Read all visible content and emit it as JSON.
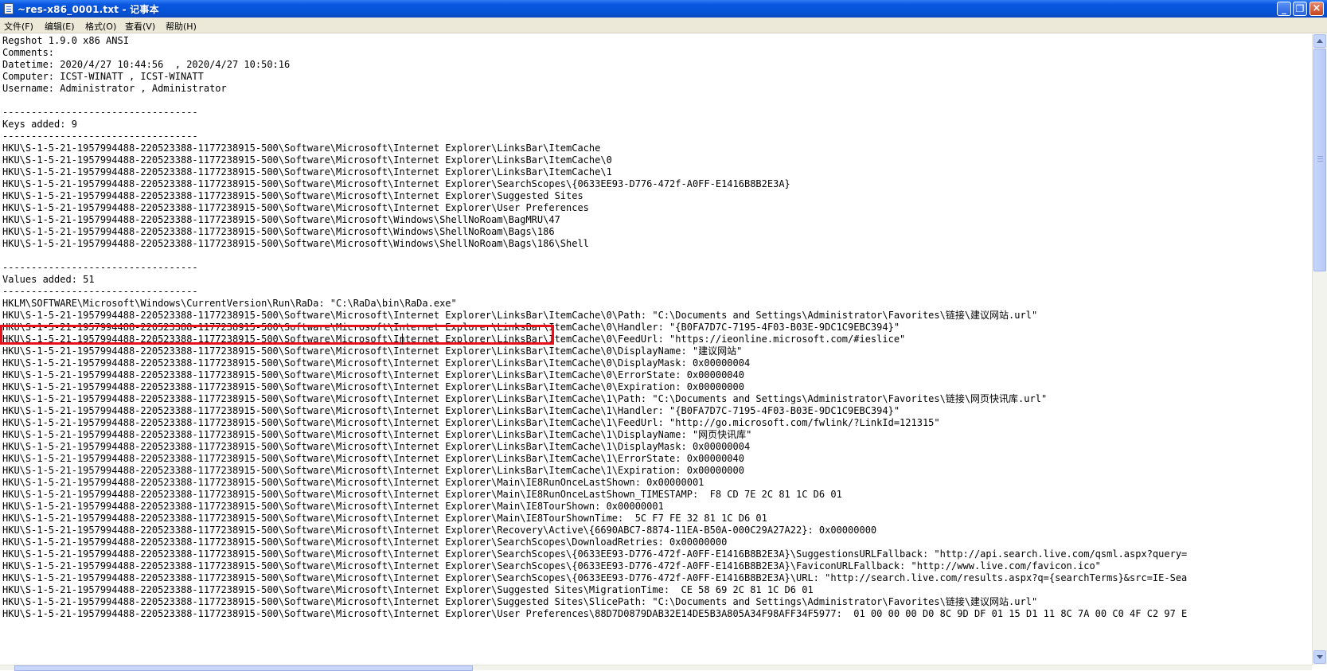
{
  "window": {
    "title": "~res-x86_0001.txt - 记事本"
  },
  "menu": [
    "文件(F)",
    "编辑(E)",
    "格式(O)",
    "查看(V)",
    "帮助(H)"
  ],
  "lines": [
    "Regshot 1.9.0 x86 ANSI",
    "Comments:",
    "Datetime: 2020/4/27 10:44:56  , 2020/4/27 10:50:16",
    "Computer: ICST-WINATT , ICST-WINATT",
    "Username: Administrator , Administrator",
    "",
    "----------------------------------",
    "Keys added: 9",
    "----------------------------------",
    "HKU\\S-1-5-21-1957994488-220523388-1177238915-500\\Software\\Microsoft\\Internet Explorer\\LinksBar\\ItemCache",
    "HKU\\S-1-5-21-1957994488-220523388-1177238915-500\\Software\\Microsoft\\Internet Explorer\\LinksBar\\ItemCache\\0",
    "HKU\\S-1-5-21-1957994488-220523388-1177238915-500\\Software\\Microsoft\\Internet Explorer\\LinksBar\\ItemCache\\1",
    "HKU\\S-1-5-21-1957994488-220523388-1177238915-500\\Software\\Microsoft\\Internet Explorer\\SearchScopes\\{0633EE93-D776-472f-A0FF-E1416B8B2E3A}",
    "HKU\\S-1-5-21-1957994488-220523388-1177238915-500\\Software\\Microsoft\\Internet Explorer\\Suggested Sites",
    "HKU\\S-1-5-21-1957994488-220523388-1177238915-500\\Software\\Microsoft\\Internet Explorer\\User Preferences",
    "HKU\\S-1-5-21-1957994488-220523388-1177238915-500\\Software\\Microsoft\\Windows\\ShellNoRoam\\BagMRU\\47",
    "HKU\\S-1-5-21-1957994488-220523388-1177238915-500\\Software\\Microsoft\\Windows\\ShellNoRoam\\Bags\\186",
    "HKU\\S-1-5-21-1957994488-220523388-1177238915-500\\Software\\Microsoft\\Windows\\ShellNoRoam\\Bags\\186\\Shell",
    "",
    "----------------------------------",
    "Values added: 51",
    "----------------------------------",
    "HKLM\\SOFTWARE\\Microsoft\\Windows\\CurrentVersion\\Run\\RaDa: \"C:\\RaDa\\bin\\RaDa.exe\"",
    "HKU\\S-1-5-21-1957994488-220523388-1177238915-500\\Software\\Microsoft\\Internet Explorer\\LinksBar\\ItemCache\\0\\Path: \"C:\\Documents and Settings\\Administrator\\Favorites\\链接\\建议网站.url\"",
    "HKU\\S-1-5-21-1957994488-220523388-1177238915-500\\Software\\Microsoft\\Internet Explorer\\LinksBar\\ItemCache\\0\\Handler: \"{B0FA7D7C-7195-4F03-B03E-9DC1C9EBC394}\"",
    "HKU\\S-1-5-21-1957994488-220523388-1177238915-500\\Software\\Microsoft\\Internet Explorer\\LinksBar\\ItemCache\\0\\FeedUrl: \"https://ieonline.microsoft.com/#ieslice\"",
    "HKU\\S-1-5-21-1957994488-220523388-1177238915-500\\Software\\Microsoft\\Internet Explorer\\LinksBar\\ItemCache\\0\\DisplayName: \"建议网站\"",
    "HKU\\S-1-5-21-1957994488-220523388-1177238915-500\\Software\\Microsoft\\Internet Explorer\\LinksBar\\ItemCache\\0\\DisplayMask: 0x00000004",
    "HKU\\S-1-5-21-1957994488-220523388-1177238915-500\\Software\\Microsoft\\Internet Explorer\\LinksBar\\ItemCache\\0\\ErrorState: 0x00000040",
    "HKU\\S-1-5-21-1957994488-220523388-1177238915-500\\Software\\Microsoft\\Internet Explorer\\LinksBar\\ItemCache\\0\\Expiration: 0x00000000",
    "HKU\\S-1-5-21-1957994488-220523388-1177238915-500\\Software\\Microsoft\\Internet Explorer\\LinksBar\\ItemCache\\1\\Path: \"C:\\Documents and Settings\\Administrator\\Favorites\\链接\\网页快讯库.url\"",
    "HKU\\S-1-5-21-1957994488-220523388-1177238915-500\\Software\\Microsoft\\Internet Explorer\\LinksBar\\ItemCache\\1\\Handler: \"{B0FA7D7C-7195-4F03-B03E-9DC1C9EBC394}\"",
    "HKU\\S-1-5-21-1957994488-220523388-1177238915-500\\Software\\Microsoft\\Internet Explorer\\LinksBar\\ItemCache\\1\\FeedUrl: \"http://go.microsoft.com/fwlink/?LinkId=121315\"",
    "HKU\\S-1-5-21-1957994488-220523388-1177238915-500\\Software\\Microsoft\\Internet Explorer\\LinksBar\\ItemCache\\1\\DisplayName: \"网页快讯库\"",
    "HKU\\S-1-5-21-1957994488-220523388-1177238915-500\\Software\\Microsoft\\Internet Explorer\\LinksBar\\ItemCache\\1\\DisplayMask: 0x00000004",
    "HKU\\S-1-5-21-1957994488-220523388-1177238915-500\\Software\\Microsoft\\Internet Explorer\\LinksBar\\ItemCache\\1\\ErrorState: 0x00000040",
    "HKU\\S-1-5-21-1957994488-220523388-1177238915-500\\Software\\Microsoft\\Internet Explorer\\LinksBar\\ItemCache\\1\\Expiration: 0x00000000",
    "HKU\\S-1-5-21-1957994488-220523388-1177238915-500\\Software\\Microsoft\\Internet Explorer\\Main\\IE8RunOnceLastShown: 0x00000001",
    "HKU\\S-1-5-21-1957994488-220523388-1177238915-500\\Software\\Microsoft\\Internet Explorer\\Main\\IE8RunOnceLastShown_TIMESTAMP:  F8 CD 7E 2C 81 1C D6 01",
    "HKU\\S-1-5-21-1957994488-220523388-1177238915-500\\Software\\Microsoft\\Internet Explorer\\Main\\IE8TourShown: 0x00000001",
    "HKU\\S-1-5-21-1957994488-220523388-1177238915-500\\Software\\Microsoft\\Internet Explorer\\Main\\IE8TourShownTime:  5C F7 FE 32 81 1C D6 01",
    "HKU\\S-1-5-21-1957994488-220523388-1177238915-500\\Software\\Microsoft\\Internet Explorer\\Recovery\\Active\\{6690ABC7-8874-11EA-B50A-000C29A27A22}: 0x00000000",
    "HKU\\S-1-5-21-1957994488-220523388-1177238915-500\\Software\\Microsoft\\Internet Explorer\\SearchScopes\\DownloadRetries: 0x00000000",
    "HKU\\S-1-5-21-1957994488-220523388-1177238915-500\\Software\\Microsoft\\Internet Explorer\\SearchScopes\\{0633EE93-D776-472f-A0FF-E1416B8B2E3A}\\SuggestionsURLFallback: \"http://api.search.live.com/qsml.aspx?query=",
    "HKU\\S-1-5-21-1957994488-220523388-1177238915-500\\Software\\Microsoft\\Internet Explorer\\SearchScopes\\{0633EE93-D776-472f-A0FF-E1416B8B2E3A}\\FaviconURLFallback: \"http://www.live.com/favicon.ico\"",
    "HKU\\S-1-5-21-1957994488-220523388-1177238915-500\\Software\\Microsoft\\Internet Explorer\\SearchScopes\\{0633EE93-D776-472f-A0FF-E1416B8B2E3A}\\URL: \"http://search.live.com/results.aspx?q={searchTerms}&src=IE-Sea",
    "HKU\\S-1-5-21-1957994488-220523388-1177238915-500\\Software\\Microsoft\\Internet Explorer\\Suggested Sites\\MigrationTime:  CE 58 69 2C 81 1C D6 01",
    "HKU\\S-1-5-21-1957994488-220523388-1177238915-500\\Software\\Microsoft\\Internet Explorer\\Suggested Sites\\SlicePath: \"C:\\Documents and Settings\\Administrator\\Favorites\\链接\\建议网站.url\"",
    "HKU\\S-1-5-21-1957994488-220523388-1177238915-500\\Software\\Microsoft\\Internet Explorer\\User Preferences\\88D7D0879DAB32E14DE5B3A805A34F98AFF34F5977:  01 00 00 00 D0 8C 9D DF 01 15 D1 11 8C 7A 00 C0 4F C2 97 E"
  ],
  "highlight": {
    "line_index": 22,
    "color": "#e8101a"
  },
  "scrollbar": {
    "vertical_position": 0.0
  }
}
